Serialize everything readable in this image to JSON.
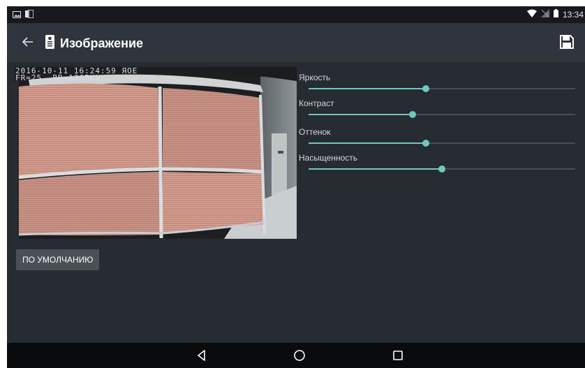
{
  "status_bar": {
    "time": "13:34",
    "icons": [
      "image-notification-icon",
      "app-notification-icon",
      "wifi-icon",
      "signal-icon",
      "battery-icon"
    ]
  },
  "app_bar": {
    "title": "Изображение",
    "back_icon": "arrow-left-icon",
    "title_icon": "intercom-panel-icon",
    "save_icon": "save-icon"
  },
  "video": {
    "osd_line1": "2016-10-11 16:24:59 ЯОЕ",
    "osd_line2": "FR=25  BR=1365Kb"
  },
  "sliders": [
    {
      "label": "Яркость",
      "value": 0.44
    },
    {
      "label": "Контраст",
      "value": 0.39
    },
    {
      "label": "Оттенок",
      "value": 0.44
    },
    {
      "label": "Насыщенность",
      "value": 0.5
    }
  ],
  "default_button": {
    "label": "ПО УМОЛЧАНИЮ"
  },
  "nav_bar": {
    "icons": [
      "back-triangle-icon",
      "home-circle-icon",
      "recents-square-icon"
    ]
  },
  "colors": {
    "background": "#262a31",
    "app_bar": "#30343d",
    "accent": "#6ec8bd",
    "button": "#4b4f56"
  }
}
